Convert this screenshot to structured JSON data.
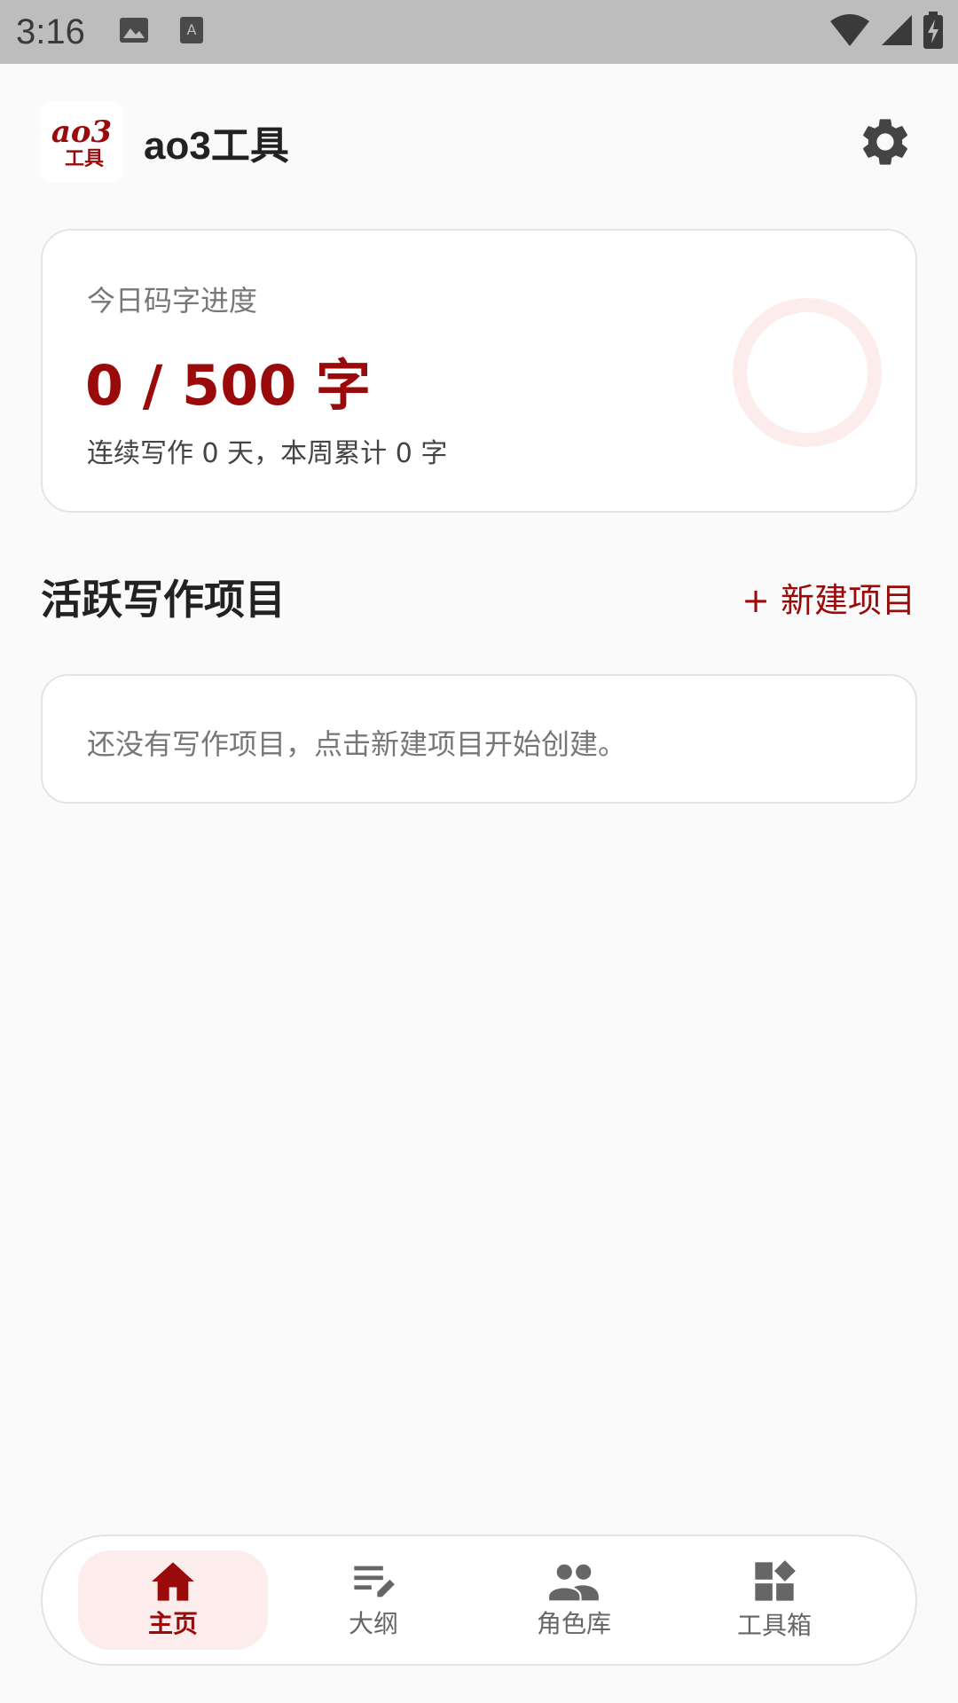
{
  "status_bar": {
    "time": "3:16"
  },
  "header": {
    "logo_text_top": "ao3",
    "logo_text_bottom": "工具",
    "title": "ao3工具"
  },
  "progress": {
    "label": "今日码字进度",
    "value": "0 / 500 字",
    "summary": "连续写作 0 天，本周累计 0 字",
    "fraction": 0
  },
  "projects": {
    "title": "活跃写作项目",
    "new_button": "+ 新建项目",
    "empty_message": "还没有写作项目，点击新建项目开始创建。"
  },
  "bottom_nav": {
    "items": [
      {
        "label": "主页",
        "icon": "home-icon",
        "active": true
      },
      {
        "label": "大纲",
        "icon": "outline-edit-icon",
        "active": false
      },
      {
        "label": "角色库",
        "icon": "people-icon",
        "active": false
      },
      {
        "label": "工具箱",
        "icon": "widgets-icon",
        "active": false
      }
    ]
  },
  "colors": {
    "accent": "#9b0a0a",
    "accent_light": "#fdecec",
    "background": "#fafafa",
    "status_bar": "#bdbdbd"
  }
}
